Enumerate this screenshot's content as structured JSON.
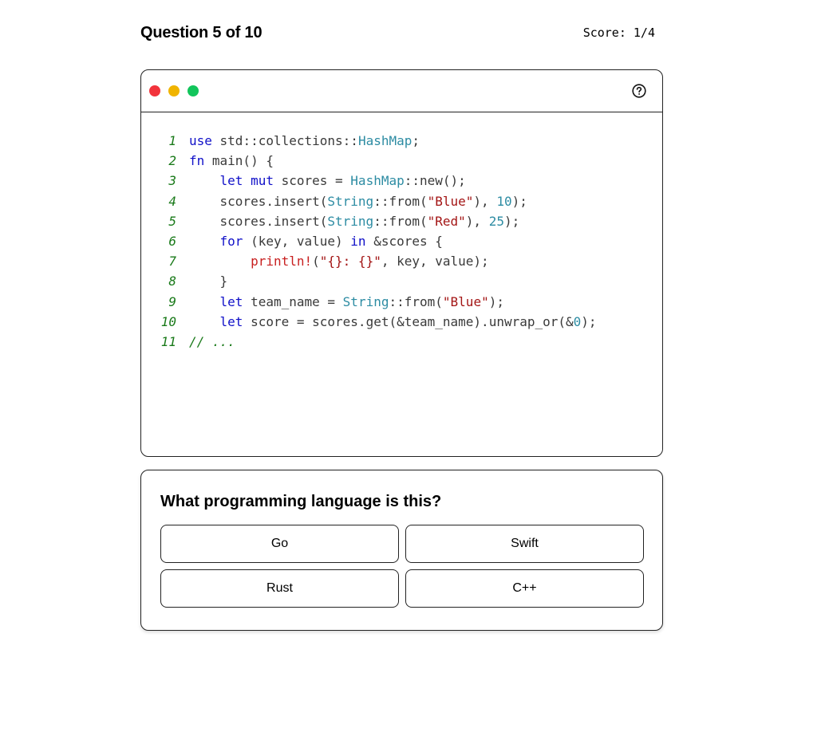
{
  "header": {
    "question_label": "Question 5 of 10",
    "score_label": "Score: 1/4"
  },
  "code_window": {
    "controls": {
      "red": "#f2333b",
      "yellow": "#f0b400",
      "green": "#12c55b"
    },
    "help_icon": "question-circle-icon",
    "lines": [
      {
        "n": "1",
        "tokens": [
          [
            "kw",
            "use"
          ],
          [
            "src",
            " std::collections::"
          ],
          [
            "ty",
            "HashMap"
          ],
          [
            "src",
            ";"
          ]
        ]
      },
      {
        "n": "2",
        "tokens": [
          [
            "kw",
            "fn"
          ],
          [
            "src",
            " main() {"
          ]
        ]
      },
      {
        "n": "3",
        "tokens": [
          [
            "src",
            "    "
          ],
          [
            "kw",
            "let mut"
          ],
          [
            "src",
            " scores = "
          ],
          [
            "ty",
            "HashMap"
          ],
          [
            "src",
            "::new();"
          ]
        ]
      },
      {
        "n": "4",
        "tokens": [
          [
            "src",
            "    scores.insert("
          ],
          [
            "ty",
            "String"
          ],
          [
            "src",
            "::from("
          ],
          [
            "st",
            "\"Blue\""
          ],
          [
            "src",
            "), "
          ],
          [
            "nu",
            "10"
          ],
          [
            "src",
            ");"
          ]
        ]
      },
      {
        "n": "5",
        "tokens": [
          [
            "src",
            "    scores.insert("
          ],
          [
            "ty",
            "String"
          ],
          [
            "src",
            "::from("
          ],
          [
            "st",
            "\"Red\""
          ],
          [
            "src",
            "), "
          ],
          [
            "nu",
            "25"
          ],
          [
            "src",
            ");"
          ]
        ]
      },
      {
        "n": "6",
        "tokens": [
          [
            "src",
            "    "
          ],
          [
            "kw",
            "for"
          ],
          [
            "src",
            " (key, value) "
          ],
          [
            "kw",
            "in"
          ],
          [
            "src",
            " &scores {"
          ]
        ]
      },
      {
        "n": "7",
        "tokens": [
          [
            "src",
            "        "
          ],
          [
            "mac",
            "println!"
          ],
          [
            "src",
            "("
          ],
          [
            "st",
            "\"{}: {}\""
          ],
          [
            "src",
            ", key, value);"
          ]
        ]
      },
      {
        "n": "8",
        "tokens": [
          [
            "src",
            "    }"
          ]
        ]
      },
      {
        "n": "9",
        "tokens": [
          [
            "src",
            "    "
          ],
          [
            "kw",
            "let"
          ],
          [
            "src",
            " team_name = "
          ],
          [
            "ty",
            "String"
          ],
          [
            "src",
            "::from("
          ],
          [
            "st",
            "\"Blue\""
          ],
          [
            "src",
            ");"
          ]
        ]
      },
      {
        "n": "10",
        "tokens": [
          [
            "src",
            "    "
          ],
          [
            "kw",
            "let"
          ],
          [
            "src",
            " score = scores.get(&team_name).unwrap_or(&"
          ],
          [
            "nu",
            "0"
          ],
          [
            "src",
            ");"
          ]
        ]
      },
      {
        "n": "11",
        "tokens": [
          [
            "cm",
            "// ..."
          ]
        ]
      }
    ]
  },
  "quiz": {
    "prompt": "What programming language is this?",
    "options": [
      "Go",
      "Swift",
      "Rust",
      "C++"
    ]
  }
}
